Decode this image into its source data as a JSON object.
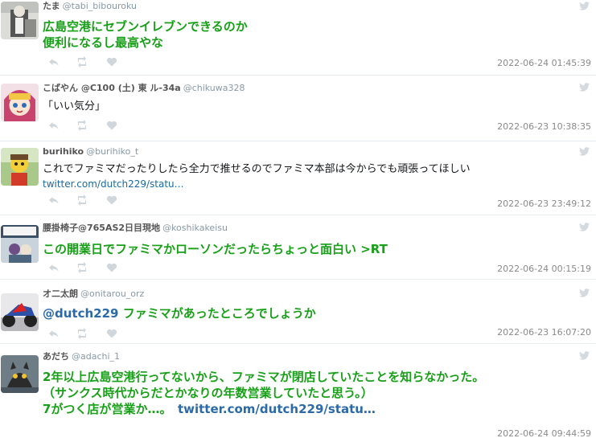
{
  "tweets": [
    {
      "name": "たま",
      "handle": "@tabi_bibouroku",
      "lines": [
        "広島空港にセブンイレブンできるのか",
        "便利になるし最高やな"
      ],
      "timestamp": "2022-06-24 01:45:39"
    },
    {
      "name": "こばやん @C100 (土) 東 ル-34a",
      "handle": "@chikuwa328",
      "lines": [
        "「いい気分」"
      ],
      "timestamp": "2022-06-23 10:38:35"
    },
    {
      "name": "burihiko",
      "handle": "@burihiko_t",
      "lines": [
        "これでファミマだったりしたら全力で推せるのでファミマ本部は今からでも頑張ってほしい"
      ],
      "link": "twitter.com/dutch229/statu…",
      "timestamp": "2022-06-23 23:49:12"
    },
    {
      "name": "腰掛椅子@765AS2日目現地",
      "handle": "@koshikakeisu",
      "lines": [
        "この開業日でファミマかローソンだったらちょっと面白い >RT"
      ],
      "timestamp": "2022-06-24 00:15:19"
    },
    {
      "name": "オ二太朗",
      "handle": "@onitarou_orz",
      "mention": "@dutch229",
      "lines": [
        "ファミマがあったところでしょうか"
      ],
      "timestamp": "2022-06-23 16:07:20"
    },
    {
      "name": "あだち",
      "handle": "@adachi_1",
      "lines": [
        "2年以上広島空港行ってないから、ファミマが閉店していたことを知らなかった。",
        "（サンクス時代からだとかなりの年数営業していたと思う。）",
        "7がつく店が営業か…。"
      ],
      "link": "twitter.com/dutch229/statu…",
      "timestamp": "2022-06-24 09:44:59"
    }
  ],
  "icons": {
    "reply": "reply-icon",
    "retweet": "retweet-icon",
    "like": "heart-icon",
    "twitter": "twitter-bird-icon"
  },
  "colors": {
    "highlight_text": "#18a018",
    "link": "#1b6a9e",
    "timestamp": "#8a8a8a",
    "icon": "#cfd6dc"
  }
}
